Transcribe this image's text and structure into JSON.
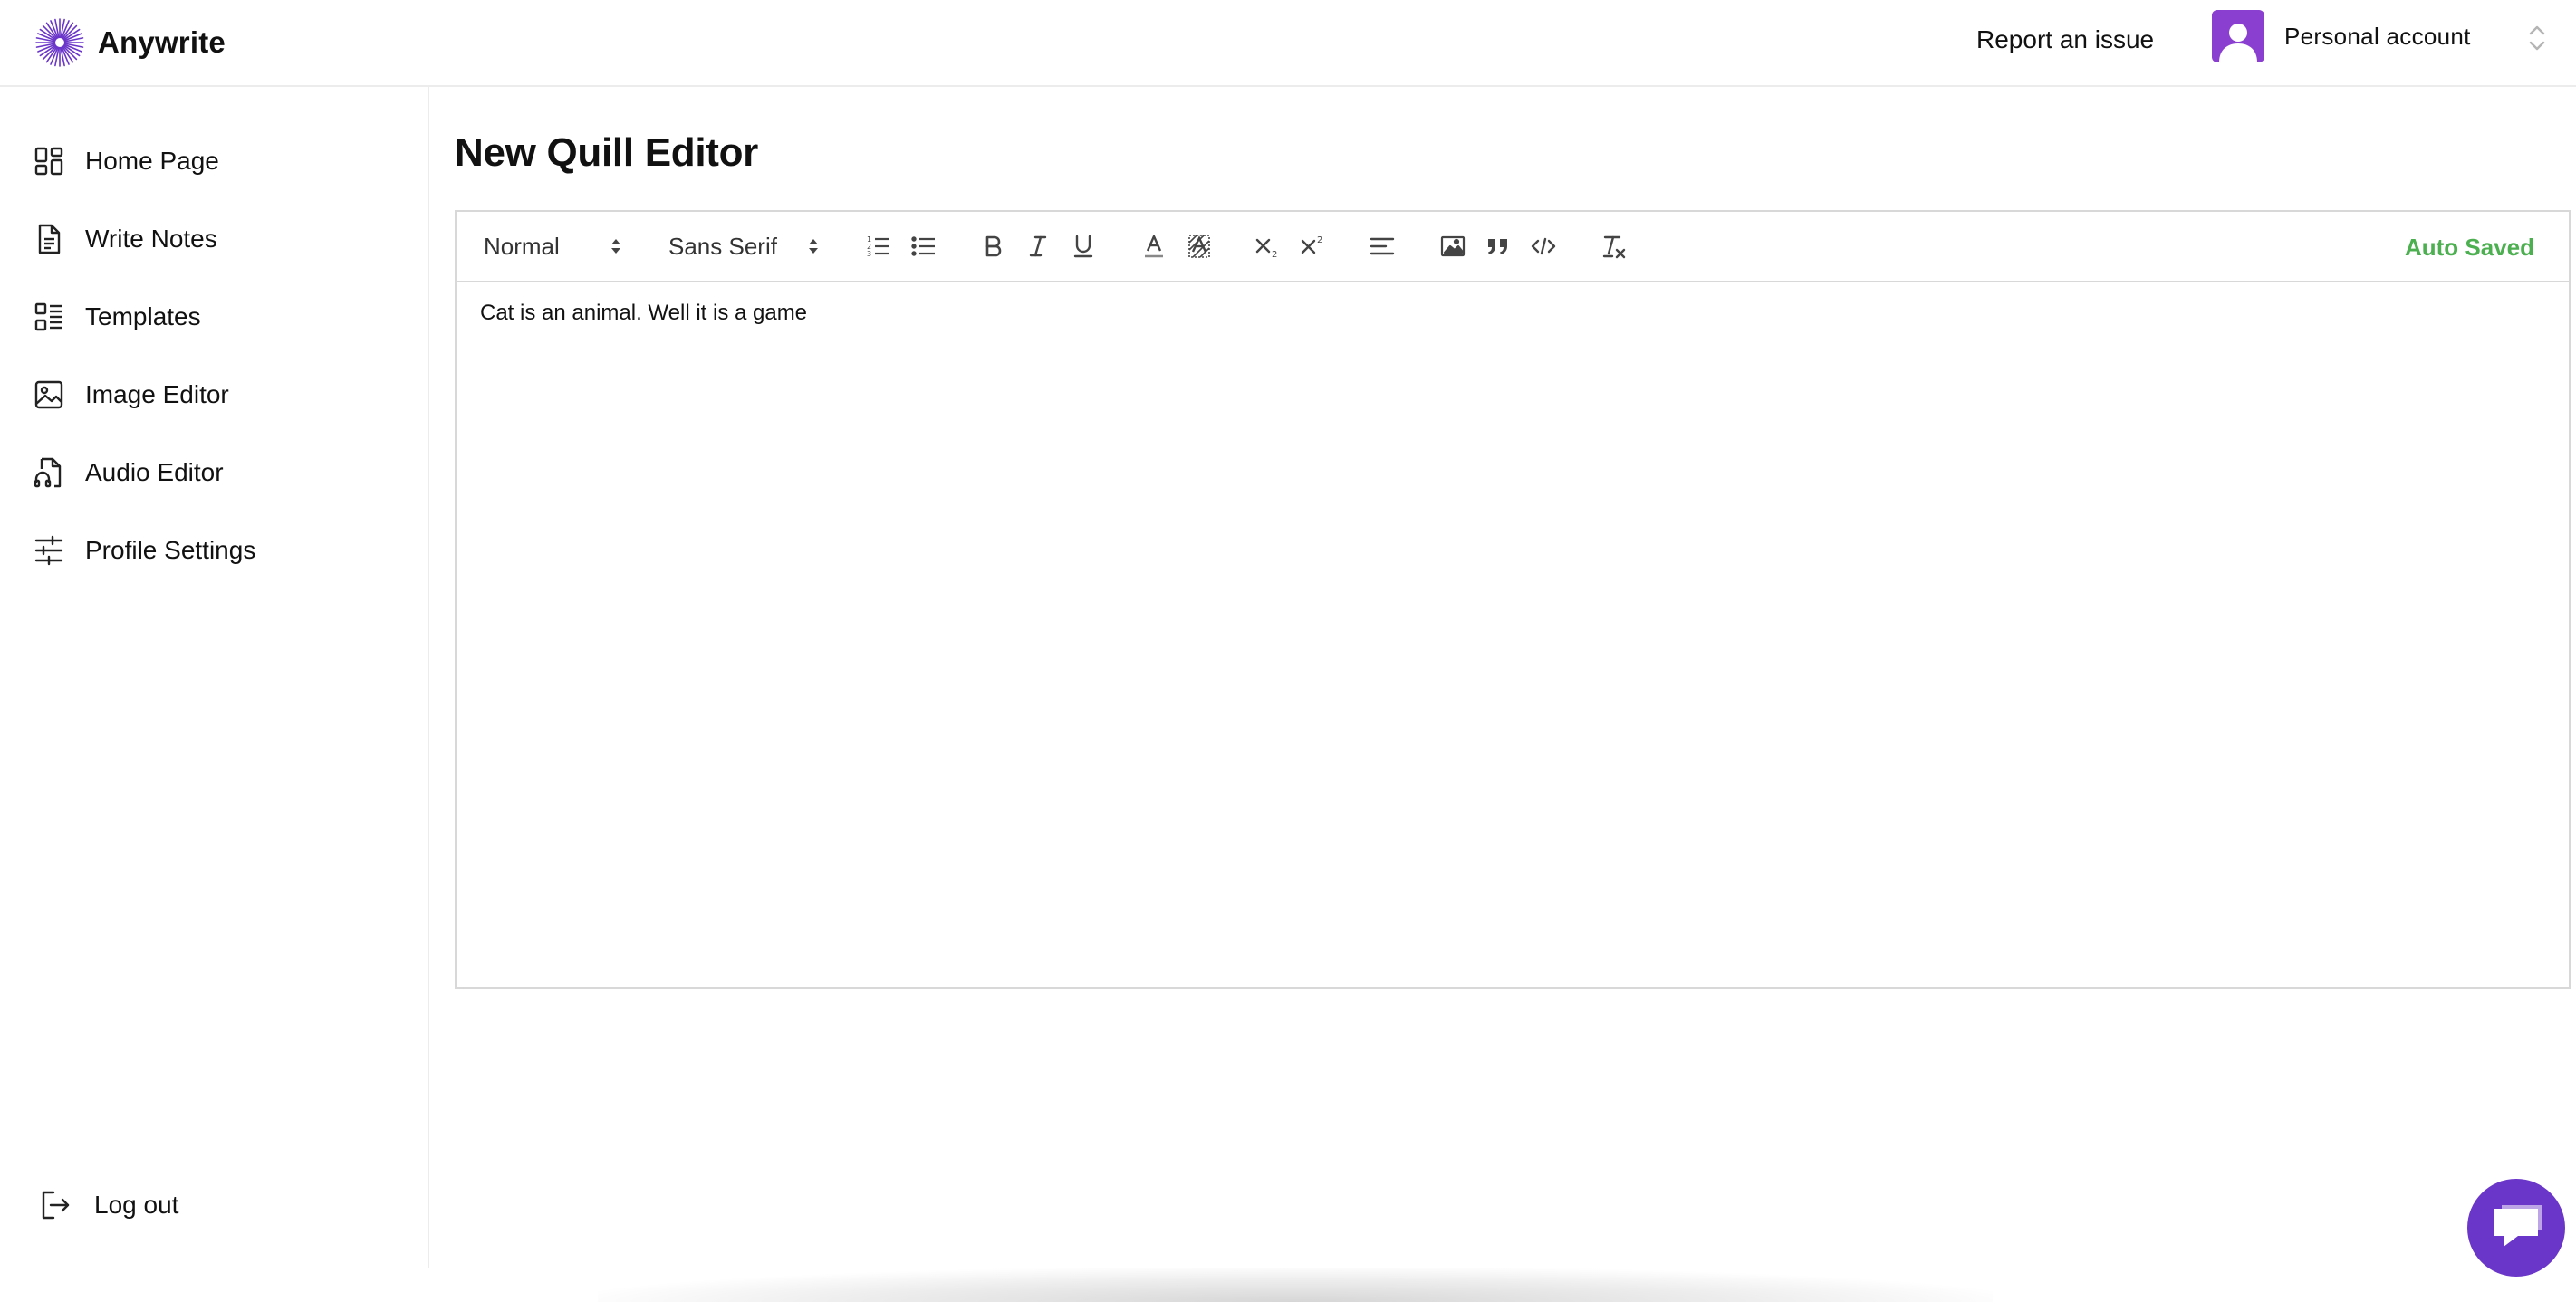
{
  "app": {
    "name": "Anywrite"
  },
  "header": {
    "report_link": "Report an issue",
    "account_label": "Personal account"
  },
  "sidebar": {
    "items": [
      {
        "label": "Home Page",
        "icon": "dashboard-icon"
      },
      {
        "label": "Write Notes",
        "icon": "document-icon"
      },
      {
        "label": "Templates",
        "icon": "list-icon"
      },
      {
        "label": "Image Editor",
        "icon": "image-icon"
      },
      {
        "label": "Audio Editor",
        "icon": "audio-file-icon"
      },
      {
        "label": "Profile Settings",
        "icon": "sliders-icon"
      }
    ],
    "logout_label": "Log out"
  },
  "main": {
    "title": "New Quill Editor",
    "toolbar": {
      "header_picker": "Normal",
      "font_picker": "Sans Serif",
      "status": "Auto Saved"
    },
    "content": "Cat is an animal. Well it is a game"
  },
  "colors": {
    "accent": "#6a35c9",
    "avatar": "#8a3fd1",
    "status_green": "#4caf50"
  }
}
